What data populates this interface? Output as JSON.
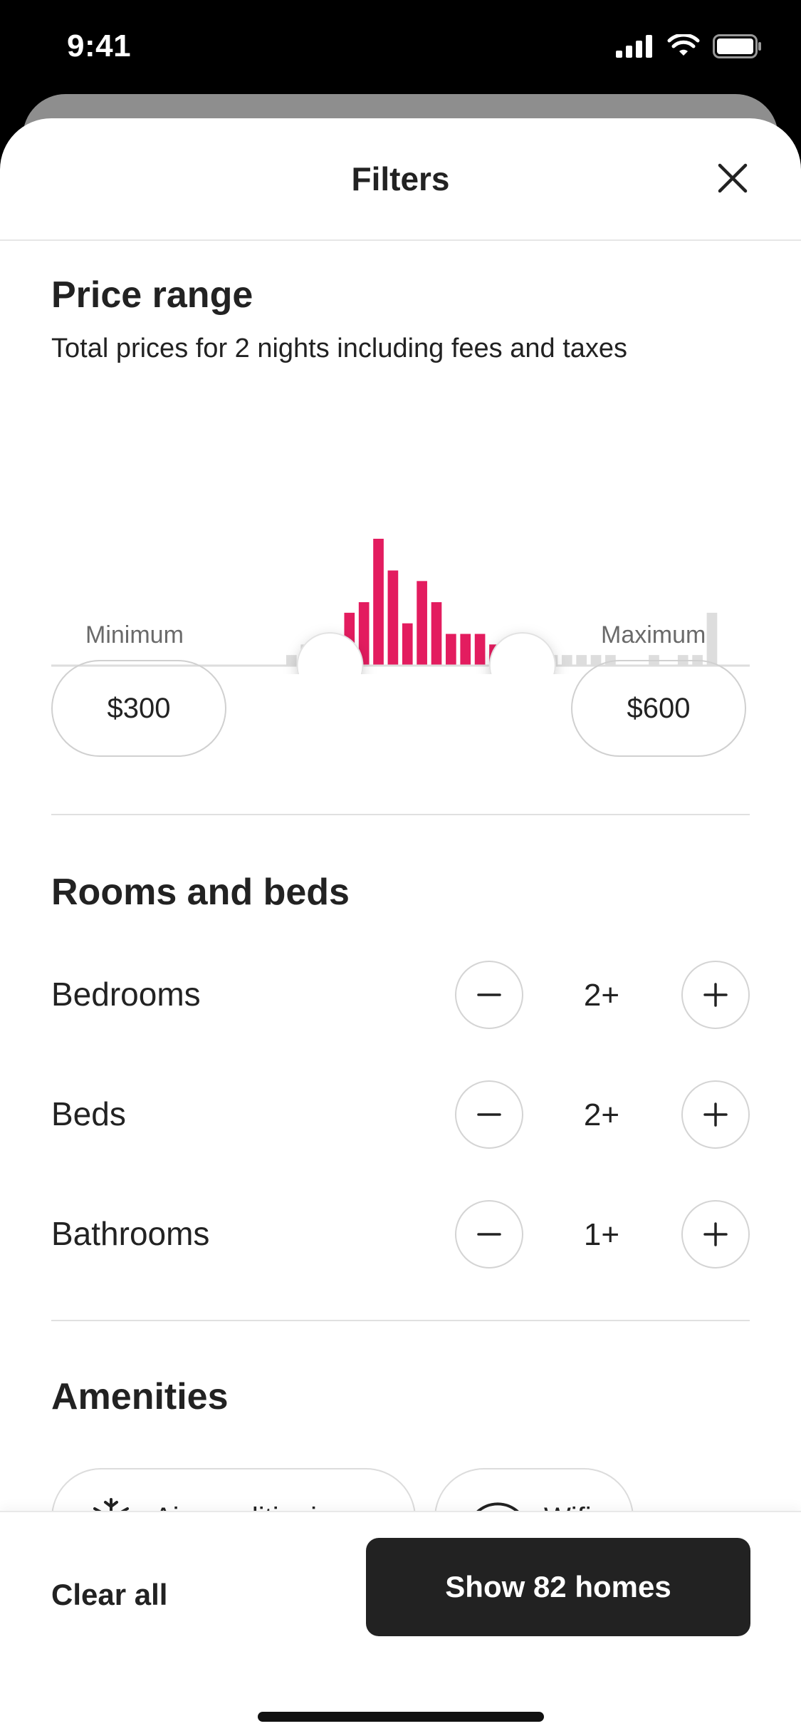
{
  "status_bar": {
    "time": "9:41"
  },
  "header": {
    "title": "Filters"
  },
  "price_range": {
    "title": "Price range",
    "subtitle": "Total prices for 2 nights including fees and taxes",
    "minimum_label": "Minimum",
    "minimum_value": "$300",
    "maximum_label": "Maximum",
    "maximum_value": "$600",
    "histogram": {
      "bars": [
        1,
        2,
        0,
        0,
        5,
        6,
        12,
        9,
        4,
        8,
        6,
        3,
        3,
        3,
        2,
        1,
        1,
        1,
        1,
        1,
        1,
        1,
        1,
        0,
        0,
        1,
        0,
        1,
        1,
        5
      ],
      "active_from": 4,
      "active_to": 15,
      "active_color": "#E31C5F",
      "inactive_color": "#DDDDDD"
    }
  },
  "rooms": {
    "title": "Rooms and beds",
    "rows": [
      {
        "label": "Bedrooms",
        "value": "2+"
      },
      {
        "label": "Beds",
        "value": "2+"
      },
      {
        "label": "Bathrooms",
        "value": "1+"
      }
    ]
  },
  "amenities": {
    "title": "Amenities",
    "chips": [
      {
        "label": "Air conditioning",
        "icon": "snowflake-icon"
      },
      {
        "label": "Wifi",
        "icon": "wifi-icon"
      }
    ]
  },
  "footer": {
    "clear_label": "Clear all",
    "show_label": "Show 82 homes"
  }
}
